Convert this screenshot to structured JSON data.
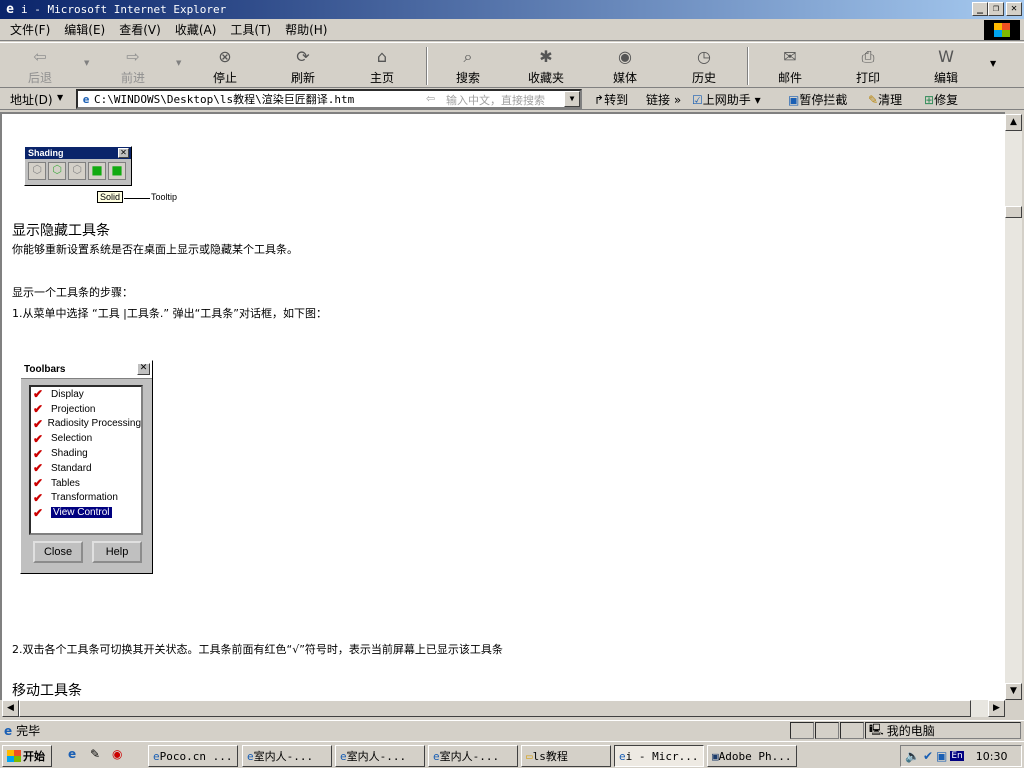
{
  "window": {
    "title": "i - Microsoft Internet Explorer"
  },
  "menu": [
    "文件(F)",
    "编辑(E)",
    "查看(V)",
    "收藏(A)",
    "工具(T)",
    "帮助(H)"
  ],
  "toolbar": {
    "back": "后退",
    "forward": "前进",
    "stop": "停止",
    "refresh": "刷新",
    "home": "主页",
    "search": "搜索",
    "favorites": "收藏夹",
    "media": "媒体",
    "history": "历史",
    "mail": "邮件",
    "print": "打印",
    "edit": "编辑"
  },
  "address": {
    "label": "地址(D)",
    "url": "C:\\WINDOWS\\Desktop\\ls教程\\渲染巨匠翻译.htm",
    "search_placeholder": "输入中文，直接搜索",
    "go": "转到",
    "links": "链接",
    "assistant": "上网助手",
    "block": "暂停拦截",
    "clean": "清理",
    "repair": "修复"
  },
  "page": {
    "shading_title": "Shading",
    "solid_label": "Solid",
    "tooltip_label": "Tooltip",
    "h1": "显示隐藏工具条",
    "p1": "你能够重新设置系统是否在桌面上显示或隐藏某个工具条。",
    "p2": "显示一个工具条的步骤：",
    "p3": "1.从菜单中选择 “工具 |工具条.” 弹出“工具条”对话框，如下图：",
    "toolbars_dialog": {
      "title": "Toolbars",
      "items": [
        "Display",
        "Projection",
        "Radiosity Processing",
        "Selection",
        "Shading",
        "Standard",
        "Tables",
        "Transformation",
        "View Control"
      ],
      "close": "Close",
      "help": "Help"
    },
    "p4": "2.双击各个工具条可切换其开关状态。工具条前面有红色“√”符号时，表示当前屏幕上已显示该工具条",
    "h2": "移动工具条"
  },
  "status": {
    "text": "完毕",
    "zone": "我的电脑"
  },
  "taskbar": {
    "start": "开始",
    "tasks": [
      "Poco.cn ...",
      "室内人-...",
      "室内人-...",
      "室内人-...",
      "ls教程",
      "i - Micr...",
      "Adobe Ph..."
    ],
    "clock": "10:30",
    "lang": "En"
  }
}
